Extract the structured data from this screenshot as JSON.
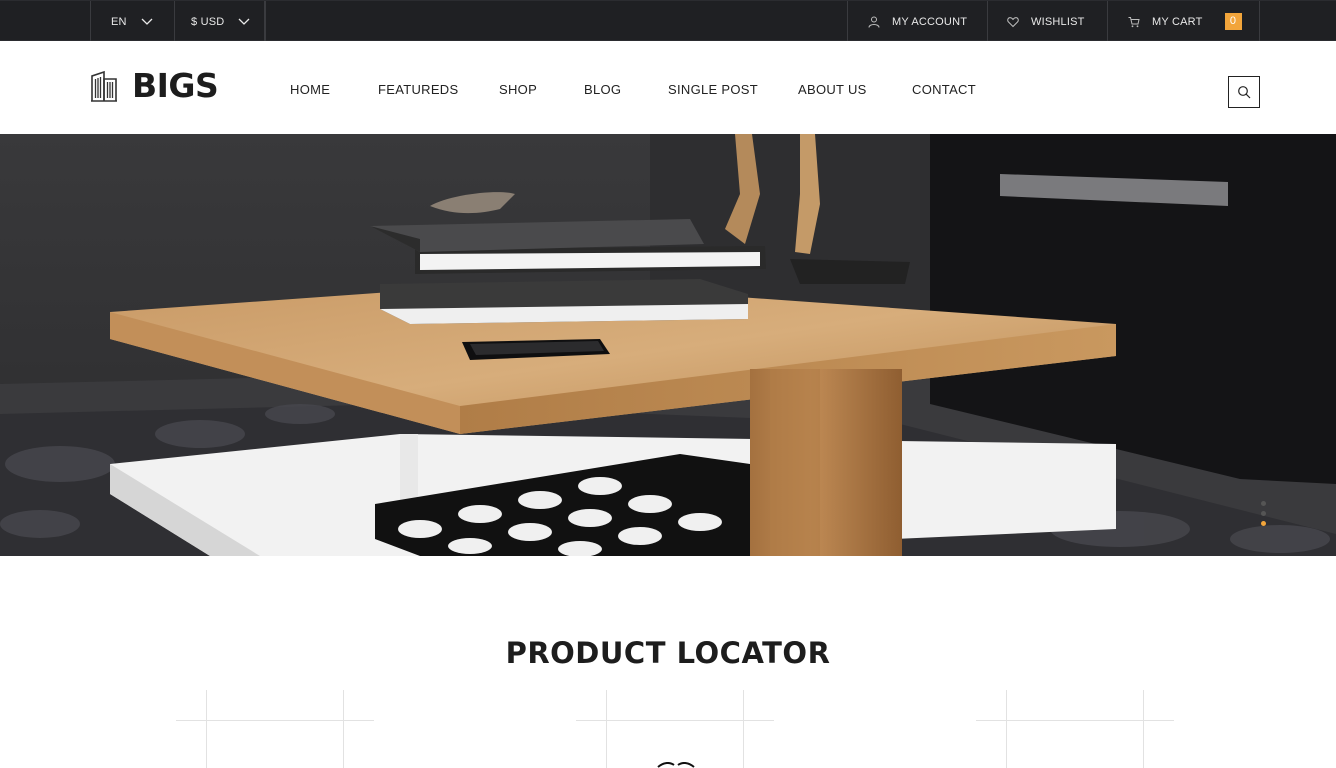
{
  "topbar": {
    "language": "EN",
    "currency": "$ USD",
    "account_label": "MY ACCOUNT",
    "wishlist_label": "WISHLIST",
    "cart_label": "MY CART",
    "cart_count": "0"
  },
  "header": {
    "logo_text": "BIGS",
    "nav": {
      "home": "HOME",
      "featureds": "FEATUREDS",
      "shop": "SHOP",
      "blog": "BLOG",
      "single_post": "SINGLE POST",
      "about_us": "ABOUT US",
      "contact": "CONTACT"
    }
  },
  "hero": {
    "slide_count": 3,
    "active_slide": 3
  },
  "section": {
    "title": "PRODUCT LOCATOR"
  },
  "colors": {
    "accent": "#f2a53b",
    "topbar_bg": "#1f2023",
    "text_dark": "#1d1d1d"
  },
  "icons": [
    "chevron-down-icon",
    "user-icon",
    "heart-icon",
    "cart-icon",
    "building-icon",
    "search-icon"
  ]
}
